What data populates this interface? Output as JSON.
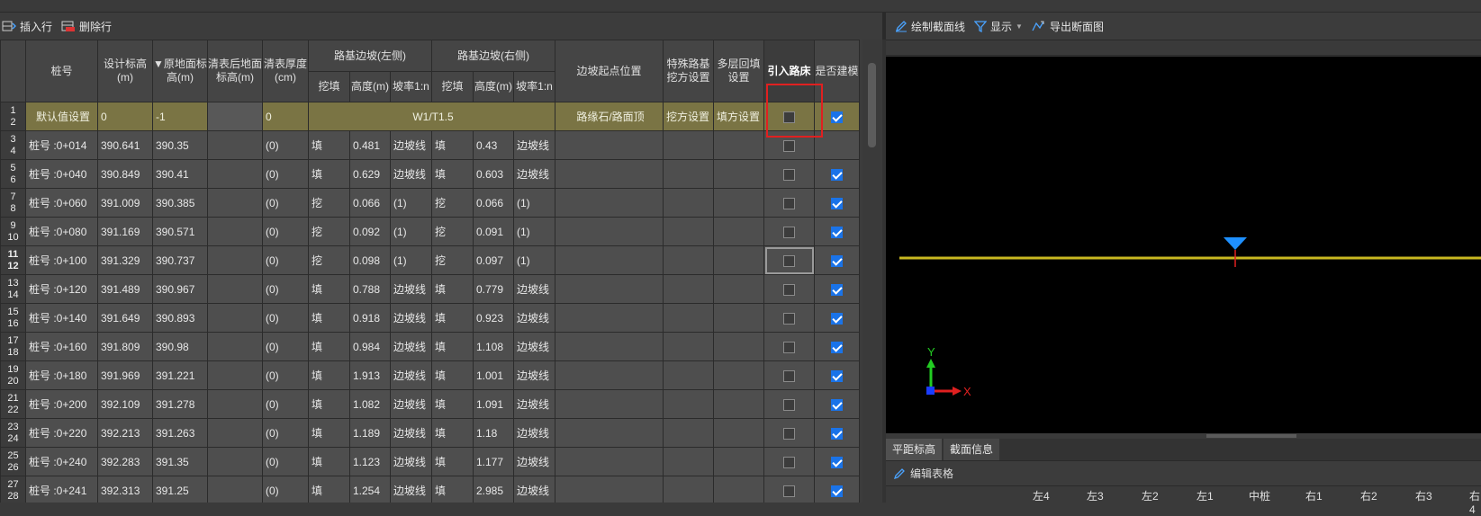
{
  "toolbar_left": {
    "insert_row": "插入行",
    "delete_row": "删除行"
  },
  "toolbar_right": {
    "draw_section": "绘制截面线",
    "display": "显示",
    "export_section": "导出断面图"
  },
  "headers": {
    "pile": "桩号",
    "design_elev": "设计标高(m)",
    "orig_ground": "▼原地面标高(m)",
    "cleared_ground": "清表后地面标高(m)",
    "clear_thick": "清表厚度(cm)",
    "slope_left": "路基边坡(左侧)",
    "slope_right": "路基边坡(右侧)",
    "cut_fill": "挖填",
    "height": "高度(m)",
    "ratio": "坡率1:n",
    "slope_start": "边坡起点位置",
    "special_cut": "特殊路基挖方设置",
    "multi_fill": "多层回填设置",
    "import_bed": "引入路床",
    "build_model": "是否建模"
  },
  "default_row": {
    "label": "默认值设置",
    "design": "0",
    "orig": "-1",
    "thick": "0",
    "slope": "W1/T1.5",
    "start": "路缘石/路面顶",
    "cut": "挖方设置",
    "fill": "填方设置",
    "import_bed": false,
    "build": true
  },
  "rows": [
    {
      "pile": "桩号 :0+014",
      "design": "390.641",
      "orig": "390.35",
      "thick": "(0)",
      "lcf": "填",
      "lh": "0.481",
      "lr": "边坡线",
      "rcf": "填",
      "rh": "0.43",
      "rr": "边坡线",
      "bed": false,
      "build": false
    },
    {
      "pile": "桩号 :0+040",
      "design": "390.849",
      "orig": "390.41",
      "thick": "(0)",
      "lcf": "填",
      "lh": "0.629",
      "lr": "边坡线",
      "rcf": "填",
      "rh": "0.603",
      "rr": "边坡线",
      "bed": false,
      "build": true
    },
    {
      "pile": "桩号 :0+060",
      "design": "391.009",
      "orig": "390.385",
      "thick": "(0)",
      "lcf": "挖",
      "lh": "0.066",
      "lr": "(1)",
      "rcf": "挖",
      "rh": "0.066",
      "rr": "(1)",
      "bed": false,
      "build": true
    },
    {
      "pile": "桩号 :0+080",
      "design": "391.169",
      "orig": "390.571",
      "thick": "(0)",
      "lcf": "挖",
      "lh": "0.092",
      "lr": "(1)",
      "rcf": "挖",
      "rh": "0.091",
      "rr": "(1)",
      "bed": false,
      "build": true
    },
    {
      "pile": "桩号 :0+100",
      "design": "391.329",
      "orig": "390.737",
      "thick": "(0)",
      "lcf": "挖",
      "lh": "0.098",
      "lr": "(1)",
      "rcf": "挖",
      "rh": "0.097",
      "rr": "(1)",
      "bed": false,
      "build": true
    },
    {
      "pile": "桩号 :0+120",
      "design": "391.489",
      "orig": "390.967",
      "thick": "(0)",
      "lcf": "填",
      "lh": "0.788",
      "lr": "边坡线",
      "rcf": "填",
      "rh": "0.779",
      "rr": "边坡线",
      "bed": false,
      "build": true
    },
    {
      "pile": "桩号 :0+140",
      "design": "391.649",
      "orig": "390.893",
      "thick": "(0)",
      "lcf": "填",
      "lh": "0.918",
      "lr": "边坡线",
      "rcf": "填",
      "rh": "0.923",
      "rr": "边坡线",
      "bed": false,
      "build": true
    },
    {
      "pile": "桩号 :0+160",
      "design": "391.809",
      "orig": "390.98",
      "thick": "(0)",
      "lcf": "填",
      "lh": "0.984",
      "lr": "边坡线",
      "rcf": "填",
      "rh": "1.108",
      "rr": "边坡线",
      "bed": false,
      "build": true
    },
    {
      "pile": "桩号 :0+180",
      "design": "391.969",
      "orig": "391.221",
      "thick": "(0)",
      "lcf": "填",
      "lh": "1.913",
      "lr": "边坡线",
      "rcf": "填",
      "rh": "1.001",
      "rr": "边坡线",
      "bed": false,
      "build": true
    },
    {
      "pile": "桩号 :0+200",
      "design": "392.109",
      "orig": "391.278",
      "thick": "(0)",
      "lcf": "填",
      "lh": "1.082",
      "lr": "边坡线",
      "rcf": "填",
      "rh": "1.091",
      "rr": "边坡线",
      "bed": false,
      "build": true
    },
    {
      "pile": "桩号 :0+220",
      "design": "392.213",
      "orig": "391.263",
      "thick": "(0)",
      "lcf": "填",
      "lh": "1.189",
      "lr": "边坡线",
      "rcf": "填",
      "rh": "1.18",
      "rr": "边坡线",
      "bed": false,
      "build": true
    },
    {
      "pile": "桩号 :0+240",
      "design": "392.283",
      "orig": "391.35",
      "thick": "(0)",
      "lcf": "填",
      "lh": "1.123",
      "lr": "边坡线",
      "rcf": "填",
      "rh": "1.177",
      "rr": "边坡线",
      "bed": false,
      "build": true
    },
    {
      "pile": "桩号 :0+241",
      "design": "392.313",
      "orig": "391.25",
      "thick": "(0)",
      "lcf": "填",
      "lh": "1.254",
      "lr": "边坡线",
      "rcf": "填",
      "rh": "2.985",
      "rr": "边坡线",
      "bed": false,
      "build": true
    }
  ],
  "row_numbers": [
    [
      "1",
      "2"
    ],
    [
      "3",
      "4"
    ],
    [
      "5",
      "6"
    ],
    [
      "7",
      "8"
    ],
    [
      "9",
      "10"
    ],
    [
      "11",
      "12"
    ],
    [
      "13",
      "14"
    ],
    [
      "15",
      "16"
    ],
    [
      "17",
      "18"
    ],
    [
      "19",
      "20"
    ],
    [
      "21",
      "22"
    ],
    [
      "23",
      "24"
    ],
    [
      "25",
      "26"
    ],
    [
      "27",
      "28"
    ]
  ],
  "tabs": [
    "平距标高",
    "截面信息"
  ],
  "edit_table": "编辑表格",
  "bottom_cols": [
    "左4",
    "左3",
    "左2",
    "左1",
    "中桩",
    "右1",
    "右2",
    "右3",
    "右4"
  ],
  "axis": {
    "y": "Y",
    "x": "X"
  },
  "colors": {
    "accent": "#1a73e8",
    "highlight_box": "#e02020",
    "section_line": "#c8b820",
    "marker": "#1e90ff"
  }
}
